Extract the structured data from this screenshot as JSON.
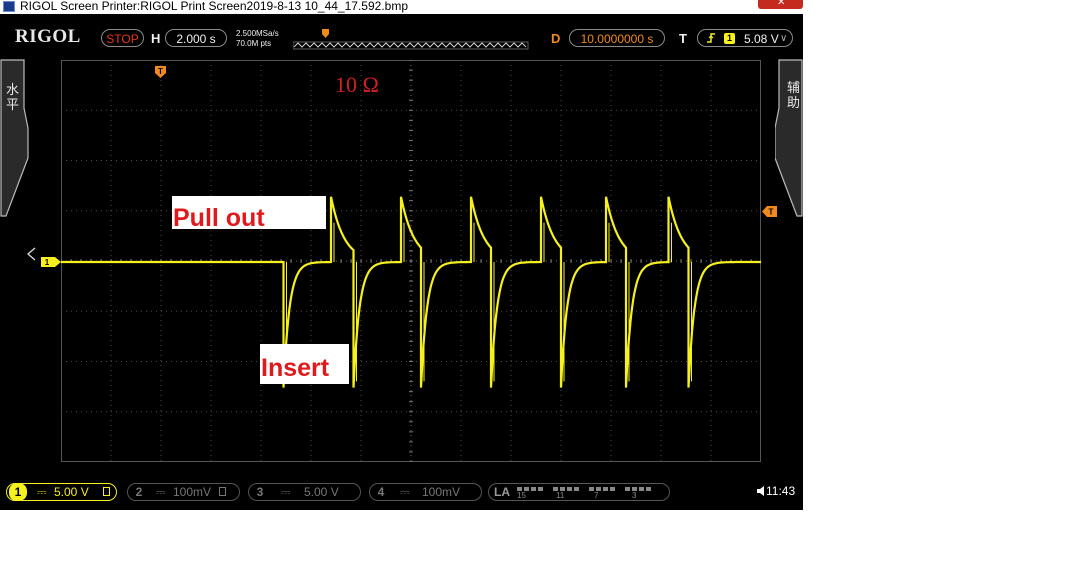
{
  "window": {
    "title": "RIGOL Screen Printer:RIGOL Print Screen2019-8-13 10_44_17.592.bmp",
    "close_glyph": "✕"
  },
  "top": {
    "brand": "RIGOL",
    "run_state": "STOP",
    "horizontal_label": "H",
    "timebase": "2.000 s",
    "sample_rate": "2.500MSa/s",
    "memory_depth": "70.0M pts",
    "delay_label": "D",
    "delay_value": "10.0000000 s",
    "trigger_label": "T",
    "trigger_channel": "1",
    "trigger_level": "5.08 V",
    "trigger_slope_icon": "rising-edge-icon"
  },
  "side": {
    "left_menu": "水平",
    "right_menu": "辅助"
  },
  "annotations": {
    "resistance": "10 Ω",
    "pull_out": "Pull out",
    "insert": "Insert"
  },
  "bottom": {
    "channels": [
      {
        "num": "1",
        "value": "5.00 V",
        "active": true
      },
      {
        "num": "2",
        "value": "100mV",
        "active": false
      },
      {
        "num": "3",
        "value": "5.00 V",
        "active": false
      },
      {
        "num": "4",
        "value": "100mV",
        "active": false
      }
    ],
    "la_label": "LA",
    "la_ticks": [
      "15",
      "11",
      "7",
      "3"
    ],
    "time": "11:43"
  },
  "colors": {
    "trace": "#f5f01e",
    "marker": "#f08a1c",
    "label_text": "#e0191c"
  },
  "chart_data": {
    "type": "line",
    "series": [
      {
        "channel": "1",
        "events": [
          {
            "kind": "insert",
            "t_div": 4.45
          },
          {
            "kind": "pull_out",
            "t_div": 5.4
          },
          {
            "kind": "insert",
            "t_div": 5.85
          },
          {
            "kind": "pull_out",
            "t_div": 6.8
          },
          {
            "kind": "insert",
            "t_div": 7.2
          },
          {
            "kind": "pull_out",
            "t_div": 8.2
          },
          {
            "kind": "insert",
            "t_div": 8.6
          },
          {
            "kind": "pull_out",
            "t_div": 9.6
          },
          {
            "kind": "insert",
            "t_div": 10.0
          },
          {
            "kind": "pull_out",
            "t_div": 10.9
          },
          {
            "kind": "insert",
            "t_div": 11.3
          },
          {
            "kind": "pull_out",
            "t_div": 12.15
          },
          {
            "kind": "insert",
            "t_div": 12.55
          }
        ],
        "baseline_div": 0,
        "pull_out_peak_div": 1.3,
        "insert_peak_div": -2.5
      }
    ],
    "x_divisions": 14,
    "y_divisions": 8,
    "grid": true
  }
}
